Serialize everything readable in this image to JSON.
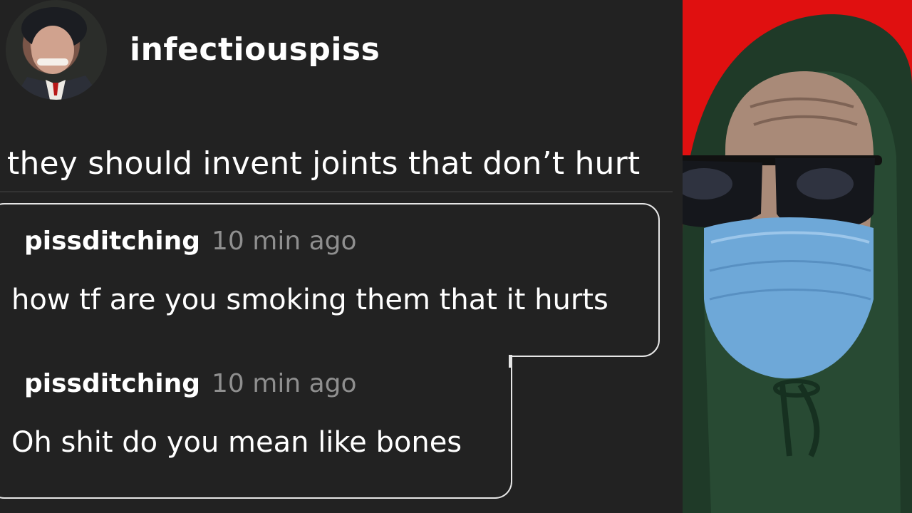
{
  "post": {
    "username": "infectiouspiss",
    "text": "they should invent joints that don’t hurt"
  },
  "replies": [
    {
      "username": "pissditching",
      "time": "10 min ago",
      "text": "how tf are you smoking them that it hurts"
    },
    {
      "username": "pissditching",
      "time": "10 min ago",
      "text": "Oh shit do you mean like bones"
    }
  ],
  "colors": {
    "background": "#222222",
    "censor": "#e00000",
    "time_gray": "#8f8f8f",
    "cam_red": "#e01010",
    "hoodie_green": "#1f3a28",
    "mask_blue": "#6ea8d8"
  }
}
